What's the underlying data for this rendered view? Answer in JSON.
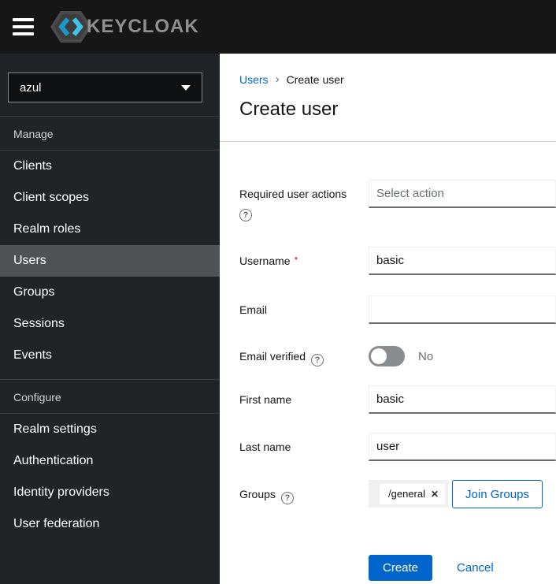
{
  "colors": {
    "accent": "#0066cc",
    "header_bg": "#161616",
    "sidebar_bg": "#212427",
    "sidebar_active_bg": "#4f5255",
    "required_red": "#c9190b",
    "toggle_off": "#8a8d90"
  },
  "header": {
    "brand": "KEYCLOAK"
  },
  "sidebar": {
    "realm": {
      "value": "azul"
    },
    "manage": {
      "label": "Manage",
      "items": [
        "Clients",
        "Client scopes",
        "Realm roles",
        "Users",
        "Groups",
        "Sessions",
        "Events"
      ],
      "active_item": "Users"
    },
    "configure": {
      "label": "Configure",
      "items": [
        "Realm settings",
        "Authentication",
        "Identity providers",
        "User federation"
      ]
    }
  },
  "breadcrumb": {
    "parent": "Users",
    "separator": "›",
    "current": "Create user"
  },
  "page_title": "Create user",
  "form": {
    "required_actions": {
      "label": "Required user actions",
      "placeholder": "Select action",
      "help_icon": "?"
    },
    "username": {
      "label": "Username",
      "required_marker": "*",
      "value": "basic"
    },
    "email": {
      "label": "Email",
      "value": ""
    },
    "email_verified": {
      "label": "Email verified",
      "help_icon": "?",
      "state_label": "No"
    },
    "first_name": {
      "label": "First name",
      "value": "basic"
    },
    "last_name": {
      "label": "Last name",
      "value": "user"
    },
    "groups": {
      "label": "Groups",
      "help_icon": "?",
      "chips": [
        "/general"
      ],
      "remove_icon": "✕",
      "join_button": "Join Groups"
    },
    "actions": {
      "create": "Create",
      "cancel": "Cancel"
    }
  }
}
